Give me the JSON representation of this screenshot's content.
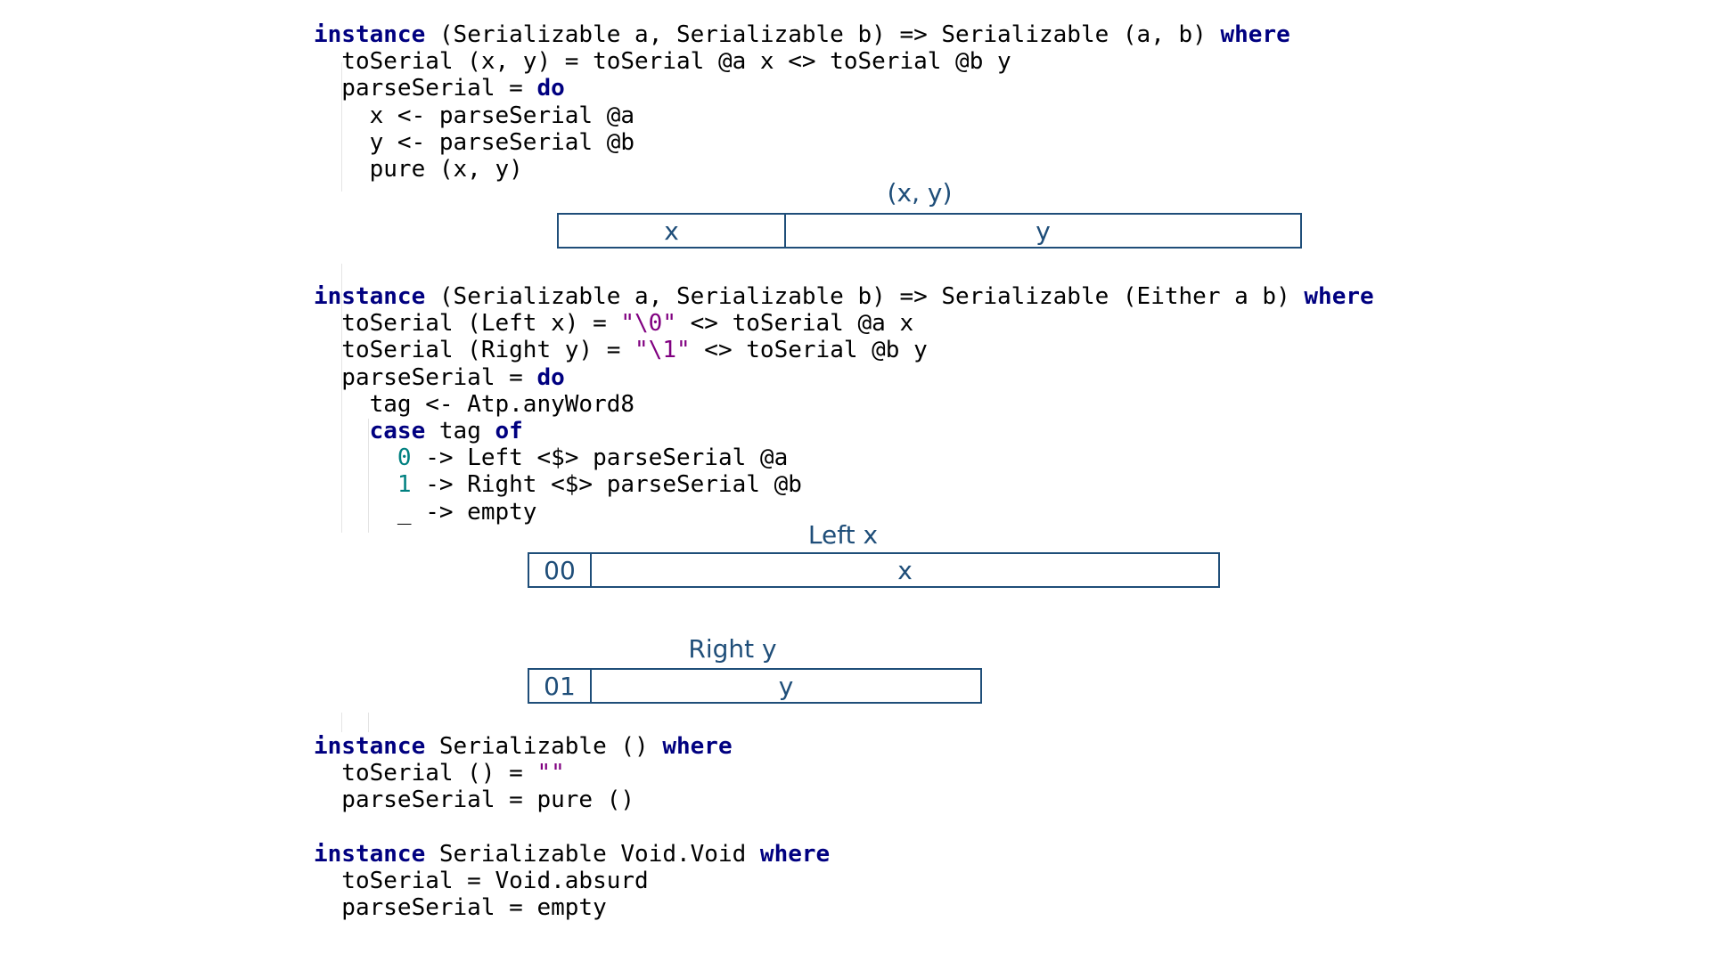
{
  "code_blocks": [
    {
      "lines": [
        [
          [
            "kw",
            "instance"
          ],
          [
            "pl",
            " (Serializable a, Serializable b) => Serializable (a, b) "
          ],
          [
            "kw",
            "where"
          ]
        ],
        [
          [
            "pl",
            "  toSerial (x, y) = toSerial @a x <> toSerial @b y"
          ]
        ],
        [
          [
            "pl",
            "  parseSerial = "
          ],
          [
            "kw",
            "do"
          ]
        ],
        [
          [
            "pl",
            "    x <- parseSerial @a"
          ]
        ],
        [
          [
            "pl",
            "    y <- parseSerial @b"
          ]
        ],
        [
          [
            "pl",
            "    pure (x, y)"
          ]
        ]
      ]
    },
    {
      "lines": [
        [
          [
            "kw",
            "instance"
          ],
          [
            "pl",
            " (Serializable a, Serializable b) => Serializable (Either a b) "
          ],
          [
            "kw",
            "where"
          ]
        ],
        [
          [
            "pl",
            "  toSerial (Left x) = "
          ],
          [
            "str",
            "\"\\0\""
          ],
          [
            "pl",
            " <> toSerial @a x"
          ]
        ],
        [
          [
            "pl",
            "  toSerial (Right y) = "
          ],
          [
            "str",
            "\"\\1\""
          ],
          [
            "pl",
            " <> toSerial @b y"
          ]
        ],
        [
          [
            "pl",
            "  parseSerial = "
          ],
          [
            "kw",
            "do"
          ]
        ],
        [
          [
            "pl",
            "    tag <- Atp.anyWord8"
          ]
        ],
        [
          [
            "pl",
            "    "
          ],
          [
            "kw",
            "case"
          ],
          [
            "pl",
            " tag "
          ],
          [
            "kw",
            "of"
          ]
        ],
        [
          [
            "pl",
            "      "
          ],
          [
            "num",
            "0"
          ],
          [
            "pl",
            " -> Left <$> parseSerial @a"
          ]
        ],
        [
          [
            "pl",
            "      "
          ],
          [
            "num",
            "1"
          ],
          [
            "pl",
            " -> Right <$> parseSerial @b"
          ]
        ],
        [
          [
            "pl",
            "      _ -> empty"
          ]
        ]
      ]
    },
    {
      "lines": [
        [
          [
            "kw",
            "instance"
          ],
          [
            "pl",
            " Serializable () "
          ],
          [
            "kw",
            "where"
          ]
        ],
        [
          [
            "pl",
            "  toSerial () = "
          ],
          [
            "str",
            "\"\""
          ]
        ],
        [
          [
            "pl",
            "  parseSerial = pure ()"
          ]
        ]
      ]
    },
    {
      "lines": [
        [
          [
            "kw",
            "instance"
          ],
          [
            "pl",
            " Serializable Void.Void "
          ],
          [
            "kw",
            "where"
          ]
        ],
        [
          [
            "pl",
            "  toSerial = Void.absurd"
          ]
        ],
        [
          [
            "pl",
            "  parseSerial = empty"
          ]
        ]
      ]
    }
  ],
  "diagrams": [
    {
      "title": "(x, y)",
      "cells": [
        "x",
        "y"
      ]
    },
    {
      "title": "Left x",
      "cells": [
        "00",
        "x"
      ]
    },
    {
      "title": "Right y",
      "cells": [
        "01",
        "y"
      ]
    }
  ],
  "colors": {
    "keyword": "#000080",
    "string": "#800080",
    "number": "#008080",
    "diagram": "#1f4e79",
    "diagram_text": "#1f4e79"
  }
}
